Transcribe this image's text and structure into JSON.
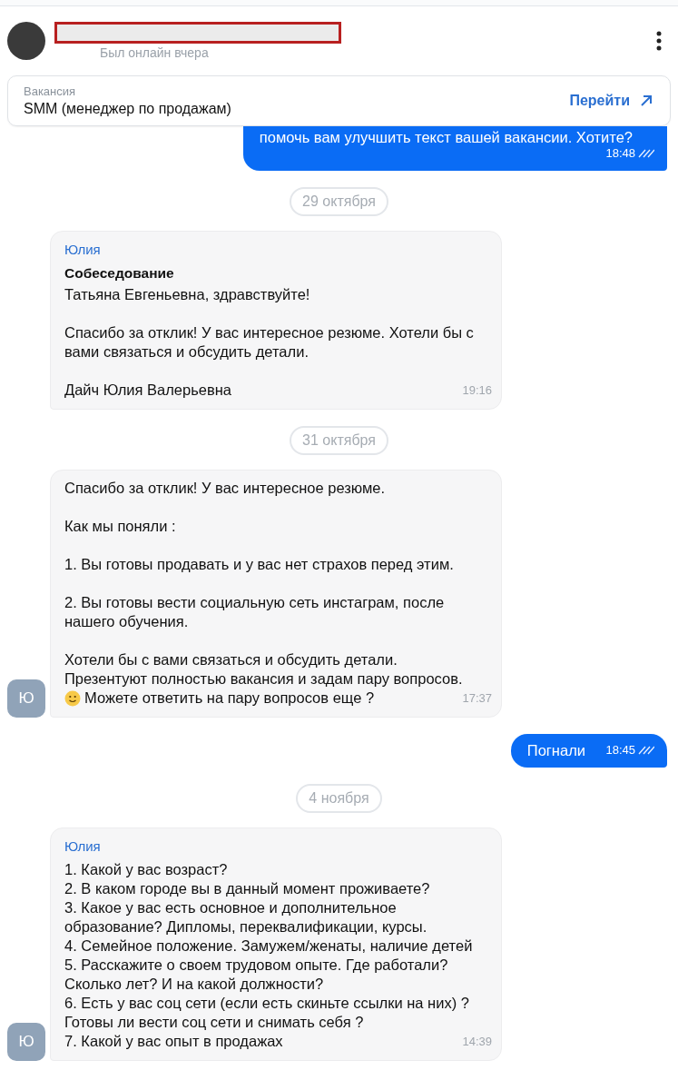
{
  "header": {
    "status": "Был онлайн вчера"
  },
  "vacancy": {
    "label": "Вакансия",
    "title": "SMM (менеджер по продажам)",
    "link": "Перейти"
  },
  "messages": [
    {
      "kind": "outgoing",
      "paragraphs": [
        [
          {
            "text": "помочь вам улучшить текст вашей вакансии. Хотите?"
          }
        ]
      ],
      "time": "18:48",
      "read": true
    },
    {
      "kind": "date",
      "text": "29 октября"
    },
    {
      "kind": "incoming",
      "sender": "Юлия",
      "title": "Собеседование",
      "paragraphs": [
        [
          {
            "text": "Татьяна Евгеньевна, здравствуйте!"
          }
        ],
        [
          {
            "text": "Спасибо за отклик! У вас интересное резюме. Хотели бы с"
          },
          {
            "text": "вами связаться и обсудить детали."
          }
        ],
        [
          {
            "text": "Дайч Юлия Валерьевна"
          }
        ]
      ],
      "time": "19:16"
    },
    {
      "kind": "date",
      "text": "31 октября"
    },
    {
      "kind": "incoming",
      "avatar": "Ю",
      "paragraphs": [
        [
          {
            "text": "Спасибо за отклик! У вас интересное резюме."
          }
        ],
        [
          {
            "text": "Как мы поняли :"
          }
        ],
        [
          {
            "text": "1. Вы готовы продавать и у вас нет страхов перед этим."
          }
        ],
        [
          {
            "text": "2. Вы готовы вести социальную сеть инстаграм, после"
          },
          {
            "text": "нашего обучения."
          }
        ],
        [
          {
            "text": "Хотели бы с вами связаться и обсудить детали."
          },
          {
            "text": "Презентуют полностью вакансия и задам пару вопросов."
          },
          {
            "text": "Можете ответить на пару вопросов еще ?",
            "emoji": true
          }
        ]
      ],
      "time": "17:37"
    },
    {
      "kind": "outgoing",
      "paragraphs": [
        [
          {
            "text": "Погнали"
          }
        ]
      ],
      "time": "18:45",
      "read": true
    },
    {
      "kind": "date",
      "text": "4 ноября"
    },
    {
      "kind": "incoming",
      "avatar": "Ю",
      "sender": "Юлия",
      "paragraphs": [
        [
          {
            "text": "1. Какой у вас возраст?"
          },
          {
            "text": "2. В каком городе вы в данный момент проживаете?"
          },
          {
            "text": "3. Какое у вас есть основное и дополнительное"
          },
          {
            "text": "образование? Дипломы, переквалификации, курсы."
          },
          {
            "text": "4. Семейное положение. Замужем/женаты, наличие детей"
          },
          {
            "text": "5. Расскажите о своем трудовом опыте. Где работали?"
          },
          {
            "text": "Сколько лет? И на какой должности?"
          },
          {
            "text": "6. Есть у вас соц сети (если есть скиньте ссылки на них) ?"
          },
          {
            "text": "Готовы ли вести соц сети и снимать себя ?"
          },
          {
            "text": "7. Какой у вас опыт в продажах"
          }
        ]
      ],
      "time": "14:39"
    }
  ]
}
